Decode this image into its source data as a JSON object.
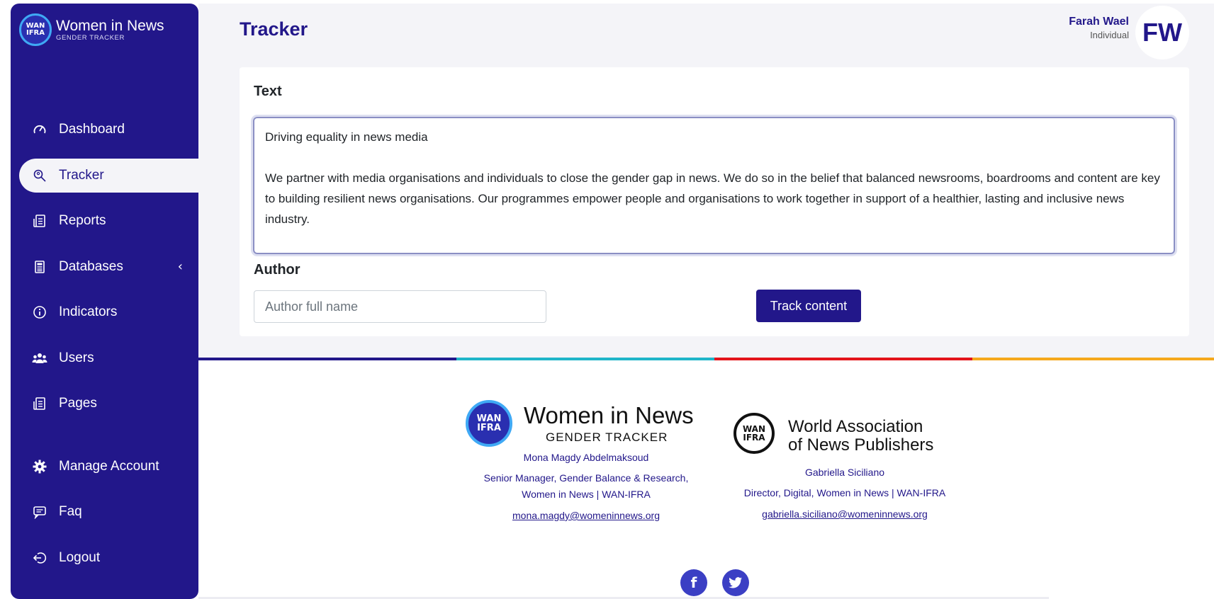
{
  "brand": {
    "logo_text": "WAN IFRA",
    "title": "Women in News",
    "subtitle": "GENDER TRACKER"
  },
  "sidebar": {
    "items": [
      {
        "label": "Dashboard",
        "icon": "speedometer-icon"
      },
      {
        "label": "Tracker",
        "icon": "tracker-search-icon",
        "active": true
      },
      {
        "label": "Reports",
        "icon": "document-icon"
      },
      {
        "label": "Databases",
        "icon": "database-icon"
      },
      {
        "label": "Indicators",
        "icon": "info-circle-icon"
      },
      {
        "label": "Users",
        "icon": "users-icon"
      },
      {
        "label": "Pages",
        "icon": "pages-icon"
      },
      {
        "label": "Manage Account",
        "icon": "gear-icon"
      },
      {
        "label": "Faq",
        "icon": "chat-icon"
      },
      {
        "label": "Logout",
        "icon": "logout-icon"
      }
    ],
    "databases_chevron": "‹"
  },
  "header": {
    "title": "Tracker",
    "user_name": "Farah Wael",
    "user_role": "Individual",
    "avatar_initials": "FW"
  },
  "form": {
    "text_label": "Text",
    "text_value": "Driving equality in news media\n\nWe partner with media organisations and individuals to close the gender gap in news. We do so in the belief that balanced newsrooms, boardrooms and content are key to building resilient news organisations. Our programmes empower people and organisations to work together in support of a healthier, lasting and inclusive news industry.",
    "author_label": "Author",
    "author_placeholder": "Author full name",
    "submit_label": "Track content"
  },
  "stripe_colors": [
    "#22178a",
    "#1fb5c9",
    "#e3141b",
    "#f5a81c"
  ],
  "footer": {
    "left": {
      "logo_text": "WAN IFRA",
      "title": "Women in News",
      "subtitle": "GENDER TRACKER",
      "name": "Mona Magdy Abdelmaksoud",
      "role_line1": "Senior Manager, Gender Balance & Research,",
      "role_line2": "Women in News | WAN-IFRA",
      "email": "mona.magdy@womeninnews.org"
    },
    "right": {
      "logo_text": "WAN IFRA",
      "title_line1": "World Association",
      "title_line2": "of News Publishers",
      "name": "Gabriella Siciliano",
      "role": "Director, Digital, Women in News | WAN-IFRA",
      "email": "gabriella.siciliano@womeninnews.org"
    },
    "social": {
      "facebook": "f",
      "twitter": "t"
    }
  }
}
